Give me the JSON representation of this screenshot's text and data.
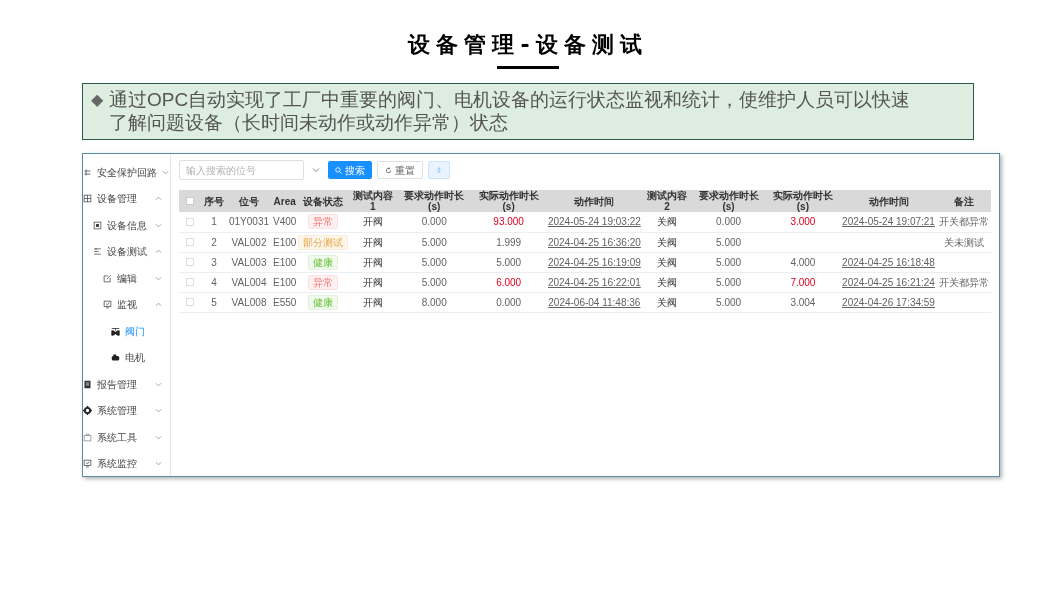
{
  "title": "设备管理-设备测试",
  "callout": {
    "marker": "◆",
    "text": "通过OPC自动实现了工厂中重要的阀门、电机设备的运行状态监视和统计，使维护人员可以快速了解问题设备（长时间未动作或动作异常）状态"
  },
  "sidebar": {
    "items": [
      {
        "label": "安全保护回路",
        "expanded": false,
        "selected": false
      },
      {
        "label": "设备管理",
        "expanded": true,
        "selected": false,
        "children": [
          {
            "label": "设备信息",
            "expanded": false,
            "selected": false
          },
          {
            "label": "设备测试",
            "expanded": true,
            "selected": false,
            "children": [
              {
                "label": "编辑",
                "expanded": false,
                "selected": false
              },
              {
                "label": "监视",
                "expanded": true,
                "selected": false,
                "children": [
                  {
                    "label": "阀门",
                    "selected": true
                  },
                  {
                    "label": "电机",
                    "selected": false
                  }
                ]
              }
            ]
          }
        ]
      },
      {
        "label": "报告管理",
        "expanded": false,
        "selected": false
      },
      {
        "label": "系统管理",
        "expanded": false,
        "selected": false
      },
      {
        "label": "系统工具",
        "expanded": false,
        "selected": false
      },
      {
        "label": "系统监控",
        "expanded": false,
        "selected": false
      }
    ]
  },
  "toolbar": {
    "search": {
      "placeholder": "输入搜索的位号"
    },
    "buttons": [
      {
        "label": "搜索",
        "kind": "primary"
      },
      {
        "label": "重置",
        "kind": "reset"
      },
      {
        "kind": "expand"
      }
    ]
  },
  "table": {
    "all_checked": false,
    "columns": [
      "序号",
      "位号",
      "Area",
      "设备状态",
      "测试内容1",
      "要求动作时长(s)",
      "实际动作时长(s)",
      "动作时间",
      "测试内容2",
      "要求动作时长(s)",
      "实际动作时长(s)",
      "动作时间",
      "备注"
    ],
    "rows": [
      {
        "checked": false,
        "no": "1",
        "tag": "01Y0031",
        "area": "V400",
        "status": {
          "text": "异常",
          "kind": "abnormal"
        },
        "test1": "开阀",
        "req1": "0.000",
        "act1": {
          "text": "93.000",
          "alert": true
        },
        "time1": "2024-05-24 19:03:22",
        "test2": "关阀",
        "req2": "0.000",
        "act2": {
          "text": "3.000",
          "alert": true
        },
        "time2": "2024-05-24 19:07:21",
        "note": "开关都异常"
      },
      {
        "checked": false,
        "no": "2",
        "tag": "VAL002",
        "area": "E100",
        "status": {
          "text": "部分测试",
          "kind": "partial"
        },
        "test1": "开阀",
        "req1": "5.000",
        "act1": {
          "text": "1.999",
          "alert": false
        },
        "time1": "2024-04-25 16:36:20",
        "test2": "关阀",
        "req2": "5.000",
        "note": "关未测试"
      },
      {
        "checked": false,
        "no": "3",
        "tag": "VAL003",
        "area": "E100",
        "status": {
          "text": "健康",
          "kind": "healthy"
        },
        "test1": "开阀",
        "req1": "5.000",
        "act1": {
          "text": "5.000",
          "alert": false
        },
        "time1": "2024-04-25 16:19:09",
        "test2": "关阀",
        "req2": "5.000",
        "act2": {
          "text": "4.000",
          "alert": false
        },
        "time2": "2024-04-25 16:18:48"
      },
      {
        "checked": false,
        "no": "4",
        "tag": "VAL004",
        "area": "E100",
        "status": {
          "text": "异常",
          "kind": "abnormal"
        },
        "test1": "开阀",
        "req1": "5.000",
        "act1": {
          "text": "6.000",
          "alert": true
        },
        "time1": "2024-04-25 16:22:01",
        "test2": "关阀",
        "req2": "5.000",
        "act2": {
          "text": "7.000",
          "alert": true
        },
        "time2": "2024-04-25 16:21:24",
        "note": "开关都异常"
      },
      {
        "checked": false,
        "no": "5",
        "tag": "VAL008",
        "area": "E550",
        "status": {
          "text": "健康",
          "kind": "healthy"
        },
        "test1": "开阀",
        "req1": "8.000",
        "act1": {
          "text": "0.000",
          "alert": false
        },
        "time1": "2024-06-04 11:48:36",
        "test2": "关阀",
        "req2": "5.000",
        "act2": {
          "text": "3.004",
          "alert": false
        },
        "time2": "2024-04-26 17:34:59"
      }
    ]
  }
}
